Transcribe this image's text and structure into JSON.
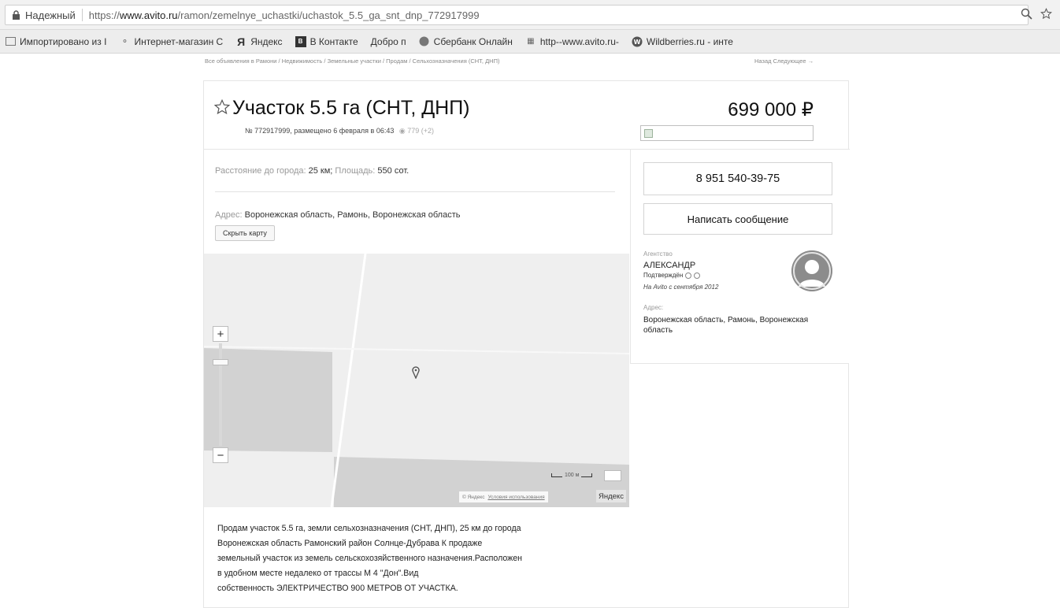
{
  "browser": {
    "secure_label": "Надежный",
    "url_prefix": "https://",
    "url_domain": "www.avito.ru",
    "url_path": "/ramon/zemelnye_uchastki/uchastok_5.5_ga_snt_dnp_772917999",
    "zoom_icon": "zoom-icon",
    "star_icon": "bookmark-star-icon",
    "bookmarks": [
      {
        "label": "Импортировано из I",
        "icon": "folder-icon"
      },
      {
        "label": "Интернет-магазин С",
        "icon": "shop-icon"
      },
      {
        "label": "Яндекс",
        "icon": "yandex-icon"
      },
      {
        "label": "В Контакте",
        "icon": "vk-icon"
      },
      {
        "label": "Добро п",
        "icon": ""
      },
      {
        "label": "Сбербанк Онлайн",
        "icon": "sberbank-icon"
      },
      {
        "label": "http--www.avito.ru-",
        "icon": "grid-icon"
      },
      {
        "label": "Wildberries.ru - инте",
        "icon": "wildberries-icon"
      }
    ]
  },
  "breadcrumbs": "Все объявления в Рамони / Недвижимость / Земельные участки / Продам / Сельхозназначения (СНТ, ДНП)",
  "nav": "Назад   Следующее →",
  "listing": {
    "title": "Участок 5.5 га (СНТ, ДНП)",
    "meta": "№ 772917999, размещено 6 февраля в 06:43",
    "views": "779 (+2)",
    "price": "699 000 ₽",
    "params_distance_label": "Расстояние до города:",
    "params_distance_value": "25 км;",
    "params_area_label": "Площадь:",
    "params_area_value": "550 сот.",
    "address_label": "Адрес:",
    "address_value": "Воронежская область, Рамонь, Воронежская область",
    "hide_map_label": "Скрыть карту",
    "description_lines": [
      "Продам участок 5.5 га, земли сельхозназначения (СНТ, ДНП), 25 км до города",
      "Воронежская область Рамонский район Солнце-Дубрава К продаже",
      "земельный участок из земель сельскохозяйственного назначения.Расположен",
      "в удобном месте недалеко от трассы М 4 \"Дон\".Вид",
      "собственность ЭЛЕКТРИЧЕСТВО 900 МЕТРОВ ОТ УЧАСТКА."
    ]
  },
  "map": {
    "zoom_in": "+",
    "zoom_out": "−",
    "scale": "100 м",
    "copyright": "© Яндекс",
    "terms": "Условия использования",
    "brand": "Яндекс"
  },
  "seller": {
    "phone": "8 951 540-39-75",
    "message_label": "Написать сообщение",
    "agency_label": "Агентство",
    "name": "АЛЕКСАНДР",
    "verified": "Подтверждён",
    "since": "На Avito с сентября 2012",
    "address_label": "Адрес:",
    "address_value": "Воронежская область, Рамонь, Воронежская область"
  }
}
